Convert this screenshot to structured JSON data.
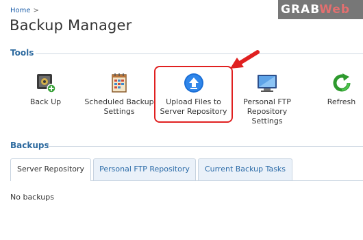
{
  "breadcrumb": {
    "home": "Home",
    "separator": ">"
  },
  "page_title": "Backup Manager",
  "tools_section": {
    "title": "Tools",
    "items": [
      {
        "label_line1": "Back Up",
        "label_line2": "",
        "label_line3": "",
        "icon": "backup-safe-icon"
      },
      {
        "label_line1": "Scheduled Backup",
        "label_line2": "Settings",
        "label_line3": "",
        "icon": "calendar-schedule-icon"
      },
      {
        "label_line1": "Upload Files to",
        "label_line2": "Server Repository",
        "label_line3": "",
        "icon": "upload-arrow-icon",
        "highlighted": true
      },
      {
        "label_line1": "Personal FTP",
        "label_line2": "Repository",
        "label_line3": "Settings",
        "icon": "ftp-monitor-icon"
      },
      {
        "label_line1": "Refresh",
        "label_line2": "",
        "label_line3": "",
        "icon": "refresh-icon"
      }
    ]
  },
  "backups_section": {
    "title": "Backups",
    "tabs": [
      {
        "label": "Server Repository",
        "active": true
      },
      {
        "label": "Personal FTP Repository",
        "active": false
      },
      {
        "label": "Current Backup Tasks",
        "active": false
      }
    ],
    "empty_message": "No backups"
  },
  "watermark": {
    "part1": "GRAB",
    "part2": "Web"
  },
  "colors": {
    "section_title": "#2d6a9f",
    "link": "#1a5ca8",
    "tab_inactive_bg": "#eaf1f9",
    "annotation_red": "#e02020"
  }
}
